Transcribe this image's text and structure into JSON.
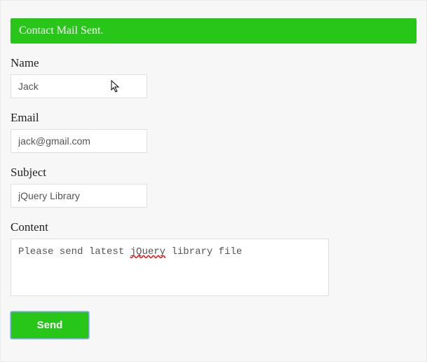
{
  "status": {
    "message": "Contact Mail Sent."
  },
  "form": {
    "name_label": "Name",
    "name_value": "Jack",
    "email_label": "Email",
    "email_value": "jack@gmail.com",
    "subject_label": "Subject",
    "subject_value": "jQuery Library",
    "content_label": "Content",
    "content_prefix": "Please send latest ",
    "content_misspell": "jQuery",
    "content_suffix": " library file",
    "send_label": "Send"
  }
}
